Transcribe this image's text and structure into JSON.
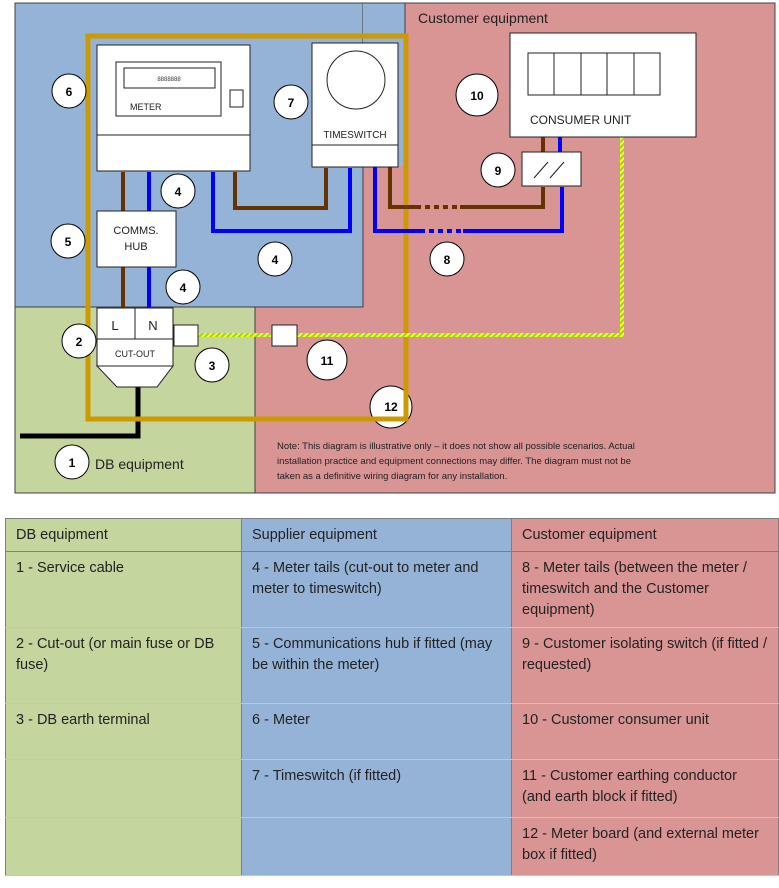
{
  "diagram": {
    "zone_labels": {
      "customer": "Customer equipment",
      "db": "DB equipment"
    },
    "components": {
      "meter_label": "METER",
      "meter_display": "8888888",
      "timeswitch_label": "TIMESWITCH",
      "consumer_unit_label": "CONSUMER UNIT",
      "comms_hub_line1": "COMMS.",
      "comms_hub_line2": "HUB",
      "cutout_live": "L",
      "cutout_neutral": "N",
      "cutout_label": "CUT-OUT"
    },
    "callouts": [
      "1",
      "2",
      "3",
      "4",
      "4",
      "4",
      "5",
      "6",
      "7",
      "8",
      "9",
      "10",
      "11",
      "12"
    ],
    "note_lines": [
      "Note: This diagram is illustrative only – it does not show all possible scenarios.  Actual",
      "installation practice and equipment connections may differ.  The diagram must not be",
      "taken as a definitive wiring diagram for any installation."
    ],
    "colors": {
      "supplier_zone": "#95b3d7",
      "customer_zone": "#d99594",
      "db_zone": "#c4d59e",
      "live": "#663300",
      "neutral": "#0000ff",
      "earth_stripe_a": "#ffff00",
      "earth_stripe_b": "#92d050",
      "meter_board": "#cc9900",
      "service_cable": "#000000"
    }
  },
  "legend": {
    "headers": [
      "DB equipment",
      "Supplier equipment",
      "Customer equipment"
    ],
    "rows": [
      [
        "1 - Service cable",
        "4 - Meter tails (cut-out to meter and meter to timeswitch)",
        "8 - Meter tails (between the meter / timeswitch and the Customer equipment)"
      ],
      [
        "2 - Cut-out (or main fuse or DB fuse)",
        "5 - Communications hub if fitted (may be within the meter)",
        "9 - Customer isolating switch (if fitted / requested)"
      ],
      [
        "3 - DB earth terminal",
        "6 - Meter",
        "10 - Customer consumer unit"
      ],
      [
        "",
        "7 - Timeswitch (if fitted)",
        "11 - Customer earthing conductor (and earth block if fitted)"
      ],
      [
        "",
        "",
        "12 - Meter board (and external meter box if fitted)"
      ]
    ]
  }
}
